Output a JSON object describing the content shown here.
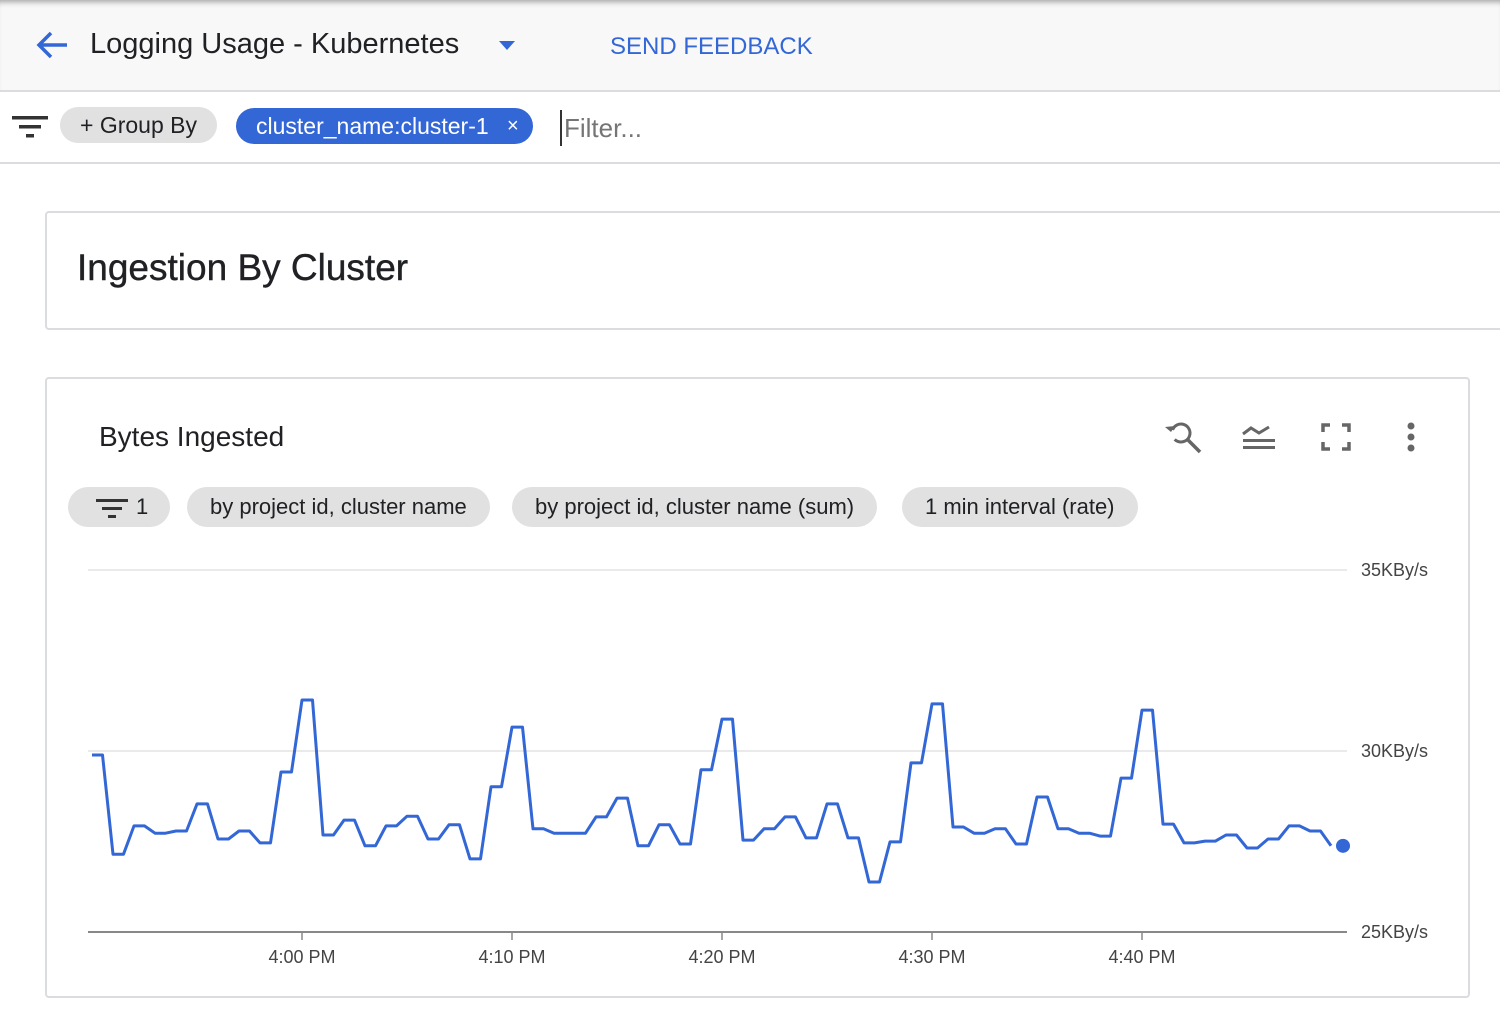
{
  "header": {
    "title": "Logging Usage - Kubernetes",
    "send_feedback": "SEND FEEDBACK",
    "back_icon": "arrow-left-icon",
    "dropdown_icon": "caret-down-icon"
  },
  "filterbar": {
    "group_by": "+ Group By",
    "active_filter": "cluster_name:cluster-1",
    "remove_label": "×",
    "filter_placeholder": "Filter...",
    "filter_value": ""
  },
  "section": {
    "title": "Ingestion By Cluster"
  },
  "widget": {
    "title": "Bytes Ingested",
    "toolbar_icons": [
      "zoom-reset-icon",
      "legend-icon",
      "fullscreen-icon",
      "more-vert-icon"
    ],
    "filter_count": "1",
    "pills": [
      "by project id, cluster name",
      "by project id, cluster name (sum)",
      "1 min interval (rate)"
    ]
  },
  "colors": {
    "accent": "#3367d6",
    "line": "#3367d6",
    "chip": "#e1e1e1"
  },
  "chart_data": {
    "type": "line",
    "title": "Bytes Ingested",
    "ylabel": "",
    "xlabel": "",
    "y_unit": "KBy/s",
    "ylim": [
      25,
      35
    ],
    "y_ticks": [
      {
        "value": 35,
        "label": "35KBy/s"
      },
      {
        "value": 30,
        "label": "30KBy/s"
      },
      {
        "value": 25,
        "label": "25KBy/s"
      }
    ],
    "x_ticks": [
      "4:00 PM",
      "4:10 PM",
      "4:20 PM",
      "4:30 PM",
      "4:40 PM"
    ],
    "grid": true,
    "start_time": "3:50 PM",
    "interval_minutes": 1,
    "series": [
      {
        "values": [
          29.89,
          27.15,
          27.93,
          27.73,
          27.79,
          28.54,
          27.57,
          27.79,
          27.46,
          29.42,
          31.41,
          27.68,
          28.09,
          27.38,
          27.93,
          28.2,
          27.57,
          27.96,
          27.02,
          29.01,
          30.66,
          27.85,
          27.73,
          27.73,
          28.18,
          28.7,
          27.38,
          27.96,
          27.43,
          29.48,
          30.88,
          27.54,
          27.85,
          28.18,
          27.6,
          28.54,
          27.6,
          26.38,
          27.49,
          29.67,
          31.3,
          27.9,
          27.73,
          27.85,
          27.43,
          28.73,
          27.85,
          27.73,
          27.65,
          29.25,
          31.13,
          27.98,
          27.46,
          27.51,
          27.68,
          27.32,
          27.57,
          27.93,
          27.79,
          27.38
        ]
      }
    ]
  }
}
